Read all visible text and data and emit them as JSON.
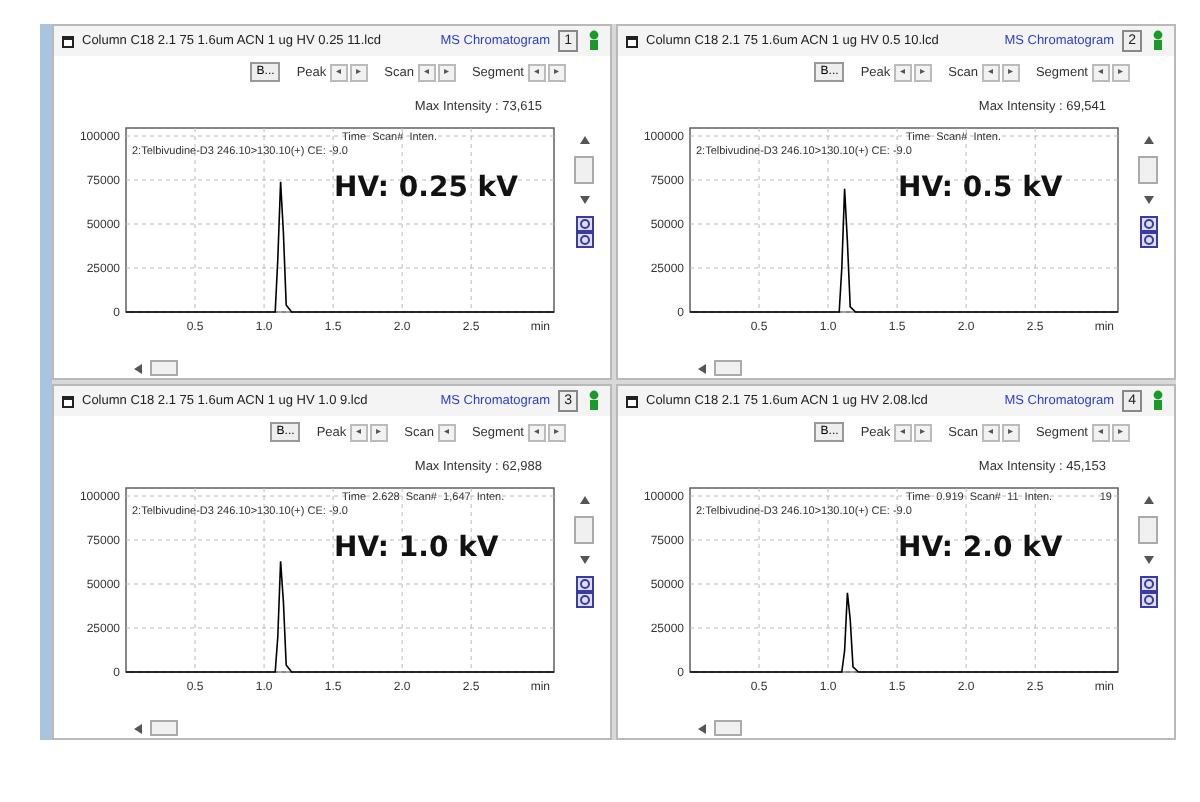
{
  "panels": [
    {
      "title": "Column C18 2.1 75 1.6um ACN 1 ug HV 0.25 11.lcd",
      "view_link": "MS Chromatogram",
      "number": "1",
      "toolbar": {
        "button": "B...",
        "groups": [
          {
            "label": "Peak",
            "arrows": [
              "◂",
              "▸"
            ]
          },
          {
            "label": "Scan",
            "arrows": [
              "◂",
              "▸"
            ]
          },
          {
            "label": "Segment",
            "arrows": [
              "◂",
              "▸"
            ]
          }
        ]
      },
      "max_intensity": "Max Intensity : 73,615",
      "cursor": {
        "time_label": "Time",
        "scan_label": "Scan#",
        "inten_label": "Inten."
      },
      "overlay_label": "HV: 0.25 kV",
      "chart_data": {
        "type": "line",
        "grid": true,
        "x": [
          0,
          1.08,
          1.1,
          1.12,
          1.14,
          1.16,
          1.2,
          3.1
        ],
        "xlim": [
          0,
          3.1
        ],
        "ylim": [
          0,
          100000
        ],
        "xticks": [
          {
            "value": 0.5,
            "label": "0.5"
          },
          {
            "value": 1,
            "label": "1.0"
          },
          {
            "value": 1.5,
            "label": "1.5"
          },
          {
            "value": 2,
            "label": "2.0"
          },
          {
            "value": 2.5,
            "label": "2.5"
          }
        ],
        "yticks": [
          0,
          25000,
          50000,
          75000,
          100000
        ],
        "xlabel": "min",
        "series": [
          {
            "name": "2:Telbivudine-D3 246.10>130.10(+) CE: -9.0",
            "color": "#000000",
            "values": [
              0,
              0,
              30000,
              74000,
              45000,
              4000,
              0,
              0
            ]
          }
        ]
      }
    },
    {
      "title": "Column C18 2.1 75 1.6um ACN 1 ug HV 0.5 10.lcd",
      "view_link": "MS Chromatogram",
      "number": "2",
      "toolbar": {
        "button": "B...",
        "groups": [
          {
            "label": "Peak",
            "arrows": [
              "◂",
              "▸"
            ]
          },
          {
            "label": "Scan",
            "arrows": [
              "◂",
              "▸"
            ]
          },
          {
            "label": "Segment",
            "arrows": [
              "◂",
              "▸"
            ]
          }
        ]
      },
      "max_intensity": "Max Intensity : 69,541",
      "cursor": {
        "time_label": "Time",
        "scan_label": "Scan#",
        "inten_label": "Inten."
      },
      "overlay_label": "HV: 0.5 kV",
      "chart_data": {
        "type": "line",
        "grid": true,
        "x": [
          0,
          1.08,
          1.1,
          1.12,
          1.14,
          1.16,
          1.2,
          3.1
        ],
        "xlim": [
          0,
          3.1
        ],
        "ylim": [
          0,
          100000
        ],
        "xticks": [
          {
            "value": 0.5,
            "label": "0.5"
          },
          {
            "value": 1,
            "label": "1.0"
          },
          {
            "value": 1.5,
            "label": "1.5"
          },
          {
            "value": 2,
            "label": "2.0"
          },
          {
            "value": 2.5,
            "label": "2.5"
          }
        ],
        "yticks": [
          0,
          25000,
          50000,
          75000,
          100000
        ],
        "xlabel": "min",
        "series": [
          {
            "name": "2:Telbivudine-D3 246.10>130.10(+) CE: -9.0",
            "color": "#000000",
            "values": [
              0,
              0,
              25000,
              70000,
              40000,
              3000,
              0,
              0
            ]
          }
        ]
      }
    },
    {
      "title": "Column C18 2.1 75 1.6um ACN 1 ug HV 1.0 9.lcd",
      "view_link": "MS Chromatogram",
      "number": "3",
      "toolbar": {
        "button": "B...",
        "groups": [
          {
            "label": "Peak",
            "arrows": [
              "◂",
              "▸"
            ]
          },
          {
            "label": "Scan",
            "arrows": [
              "◂"
            ]
          },
          {
            "label": "Segment",
            "arrows": [
              "◂",
              "▸"
            ]
          }
        ]
      },
      "max_intensity": "Max Intensity : 62,988",
      "cursor": {
        "time_label": "Time",
        "time": "2.628",
        "scan_label": "Scan#",
        "scan": "1,647",
        "inten_label": "Inten."
      },
      "overlay_label": "HV: 1.0 kV",
      "chart_data": {
        "type": "line",
        "grid": true,
        "x": [
          0,
          1.08,
          1.1,
          1.12,
          1.14,
          1.16,
          1.2,
          3.1
        ],
        "xlim": [
          0,
          3.1
        ],
        "ylim": [
          0,
          100000
        ],
        "xticks": [
          {
            "value": 0.5,
            "label": "0.5"
          },
          {
            "value": 1,
            "label": "1.0"
          },
          {
            "value": 1.5,
            "label": "1.5"
          },
          {
            "value": 2,
            "label": "2.0"
          },
          {
            "value": 2.5,
            "label": "2.5"
          }
        ],
        "yticks": [
          0,
          25000,
          50000,
          75000,
          100000
        ],
        "xlabel": "min",
        "series": [
          {
            "name": "2:Telbivudine-D3 246.10>130.10(+) CE: -9.0",
            "color": "#000000",
            "values": [
              0,
              0,
              20000,
              63000,
              40000,
              4000,
              0,
              0
            ]
          }
        ]
      }
    },
    {
      "title": "Column C18 2.1 75 1.6um ACN 1 ug HV 2.08.lcd",
      "view_link": "MS Chromatogram",
      "number": "4",
      "toolbar": {
        "button": "B...",
        "groups": [
          {
            "label": "Peak",
            "arrows": [
              "◂",
              "▸"
            ]
          },
          {
            "label": "Scan",
            "arrows": [
              "◂",
              "▸"
            ]
          },
          {
            "label": "Segment",
            "arrows": [
              "◂",
              "▸"
            ]
          }
        ]
      },
      "max_intensity": "Max Intensity : 45,153",
      "cursor": {
        "time_label": "Time",
        "time": "0.919",
        "scan_label": "Scan#",
        "scan": "11",
        "inten_label": "Inten.",
        "inten": "19"
      },
      "overlay_label": "HV: 2.0 kV",
      "chart_data": {
        "type": "line",
        "grid": true,
        "x": [
          0,
          1.1,
          1.12,
          1.14,
          1.16,
          1.18,
          1.22,
          3.1
        ],
        "xlim": [
          0,
          3.1
        ],
        "ylim": [
          0,
          100000
        ],
        "xticks": [
          {
            "value": 0.5,
            "label": "0.5"
          },
          {
            "value": 1,
            "label": "1.0"
          },
          {
            "value": 1.5,
            "label": "1.5"
          },
          {
            "value": 2,
            "label": "2.0"
          },
          {
            "value": 2.5,
            "label": "2.5"
          }
        ],
        "yticks": [
          0,
          25000,
          50000,
          75000,
          100000
        ],
        "xlabel": "min",
        "series": [
          {
            "name": "2:Telbivudine-D3 246.10>130.10(+) CE: -9.0",
            "color": "#000000",
            "values": [
              0,
              0,
              12000,
              45000,
              30000,
              3000,
              0,
              0
            ]
          }
        ]
      }
    }
  ]
}
